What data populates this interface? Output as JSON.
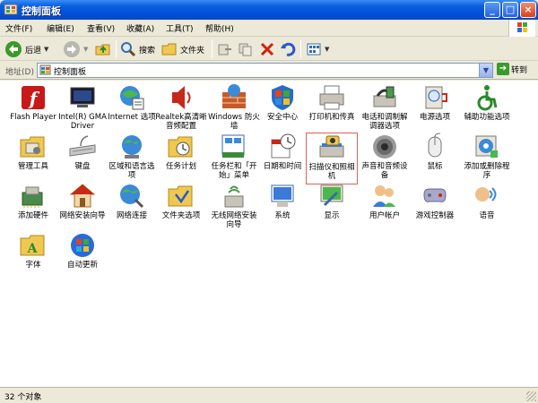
{
  "window": {
    "title": "控制面板"
  },
  "menu": [
    "文件(F)",
    "编辑(E)",
    "查看(V)",
    "收藏(A)",
    "工具(T)",
    "帮助(H)"
  ],
  "toolbar": {
    "back": "后退",
    "search": "搜索",
    "folders": "文件夹"
  },
  "address": {
    "label": "地址(D)",
    "value": "控制面板",
    "go": "转到"
  },
  "items": [
    {
      "label": "Flash Player",
      "icon": "flash-player-icon"
    },
    {
      "label": "Intel(R) GMA Driver",
      "icon": "intel-gma-icon"
    },
    {
      "label": "Internet 选项",
      "icon": "internet-options-icon"
    },
    {
      "label": "Realtek高清晰音频配置",
      "icon": "realtek-audio-icon"
    },
    {
      "label": "Windows 防火墙",
      "icon": "firewall-icon"
    },
    {
      "label": "安全中心",
      "icon": "security-center-icon"
    },
    {
      "label": "打印机和传真",
      "icon": "printer-fax-icon"
    },
    {
      "label": "电话和调制解调器选项",
      "icon": "phone-modem-icon"
    },
    {
      "label": "电源选项",
      "icon": "power-options-icon"
    },
    {
      "label": "辅助功能选项",
      "icon": "accessibility-icon"
    },
    {
      "label": "管理工具",
      "icon": "admin-tools-icon"
    },
    {
      "label": "键盘",
      "icon": "keyboard-icon"
    },
    {
      "label": "区域和语言选项",
      "icon": "region-language-icon"
    },
    {
      "label": "任务计划",
      "icon": "scheduled-tasks-icon"
    },
    {
      "label": "任务栏和「开始」菜单",
      "icon": "taskbar-start-icon"
    },
    {
      "label": "日期和时间",
      "icon": "date-time-icon"
    },
    {
      "label": "扫描仪和照相机",
      "icon": "scanner-camera-icon"
    },
    {
      "label": "声音和音频设备",
      "icon": "sound-audio-icon"
    },
    {
      "label": "鼠标",
      "icon": "mouse-icon"
    },
    {
      "label": "添加或删除程序",
      "icon": "add-remove-programs-icon"
    },
    {
      "label": "添加硬件",
      "icon": "add-hardware-icon"
    },
    {
      "label": "网络安装向导",
      "icon": "network-setup-wizard-icon"
    },
    {
      "label": "网络连接",
      "icon": "network-connections-icon"
    },
    {
      "label": "文件夹选项",
      "icon": "folder-options-icon"
    },
    {
      "label": "无线网络安装向导",
      "icon": "wireless-wizard-icon"
    },
    {
      "label": "系统",
      "icon": "system-icon"
    },
    {
      "label": "显示",
      "icon": "display-icon"
    },
    {
      "label": "用户帐户",
      "icon": "user-accounts-icon"
    },
    {
      "label": "游戏控制器",
      "icon": "game-controllers-icon"
    },
    {
      "label": "语音",
      "icon": "speech-icon"
    },
    {
      "label": "字体",
      "icon": "fonts-icon"
    },
    {
      "label": "自动更新",
      "icon": "auto-update-icon"
    }
  ],
  "status": {
    "text": "32 个对象"
  },
  "colors": {
    "titlebar": "#0050d8",
    "selection_border": "#e0605a"
  }
}
